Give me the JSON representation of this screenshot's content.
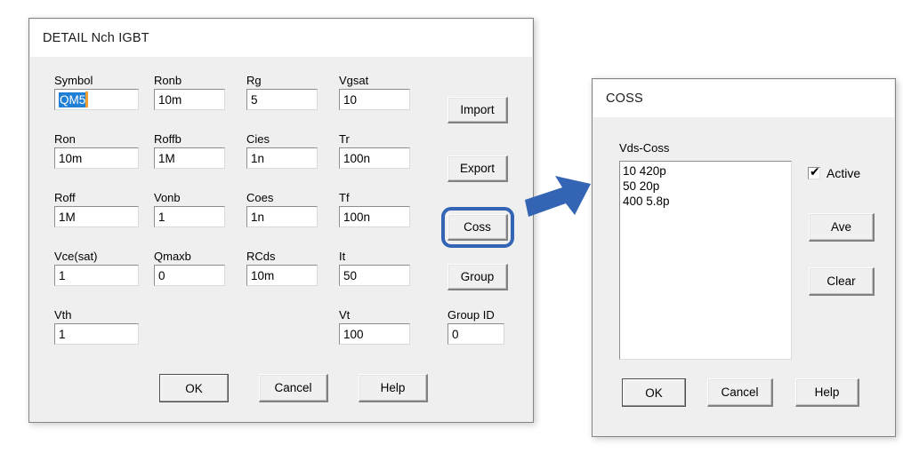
{
  "detail_dialog": {
    "title": "DETAIL Nch IGBT",
    "fields": [
      {
        "label": "Symbol",
        "value": "QM5",
        "selected": true
      },
      {
        "label": "Ronb",
        "value": "10m"
      },
      {
        "label": "Rg",
        "value": "5"
      },
      {
        "label": "Vgsat",
        "value": "10"
      },
      {
        "label": "Ron",
        "value": "10m"
      },
      {
        "label": "Roffb",
        "value": "1M"
      },
      {
        "label": "Cies",
        "value": "1n"
      },
      {
        "label": "Tr",
        "value": "100n"
      },
      {
        "label": "Roff",
        "value": "1M"
      },
      {
        "label": "Vonb",
        "value": "1"
      },
      {
        "label": "Coes",
        "value": "1n"
      },
      {
        "label": "Tf",
        "value": "100n"
      },
      {
        "label": "Vce(sat)",
        "value": "1"
      },
      {
        "label": "Qmaxb",
        "value": "0"
      },
      {
        "label": "RCds",
        "value": "10m"
      },
      {
        "label": "It",
        "value": "50"
      },
      {
        "label": "Vth",
        "value": "1"
      },
      {
        "label": "Vt",
        "value": "100"
      },
      {
        "label": "Group ID",
        "value": "0"
      }
    ],
    "side_buttons": [
      {
        "label": "Import"
      },
      {
        "label": "Export"
      },
      {
        "label": "Coss",
        "highlighted": true
      },
      {
        "label": "Group"
      }
    ],
    "bottom_buttons": [
      {
        "label": "OK",
        "focused": true
      },
      {
        "label": "Cancel"
      },
      {
        "label": "Help"
      }
    ]
  },
  "coss_dialog": {
    "title": "COSS",
    "list_label": "Vds-Coss",
    "list_items": [
      "10 420p",
      "50 20p",
      "400 5.8p"
    ],
    "active_checkbox": {
      "label": "Active",
      "checked": true,
      "glyph": "✔"
    },
    "side_buttons": [
      {
        "label": "Ave"
      },
      {
        "label": "Clear"
      }
    ],
    "bottom_buttons": [
      {
        "label": "OK",
        "focused": true
      },
      {
        "label": "Cancel"
      },
      {
        "label": "Help"
      }
    ]
  },
  "annotation": {
    "arrow_color": "#3465b4",
    "highlight_color": "#3465b4"
  }
}
